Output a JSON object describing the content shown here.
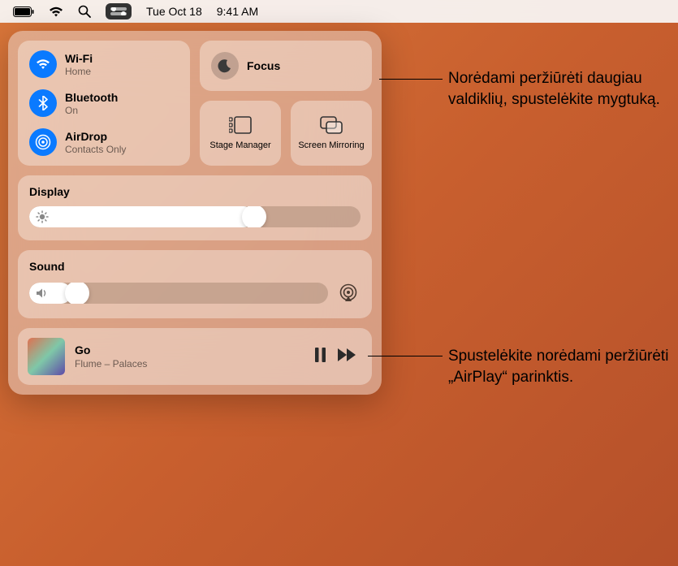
{
  "menubar": {
    "date": "Tue Oct 18",
    "time": "9:41 AM"
  },
  "connectivity": {
    "wifi": {
      "title": "Wi-Fi",
      "sub": "Home"
    },
    "bluetooth": {
      "title": "Bluetooth",
      "sub": "On"
    },
    "airdrop": {
      "title": "AirDrop",
      "sub": "Contacts Only"
    }
  },
  "focus": {
    "title": "Focus"
  },
  "stage_manager": {
    "label": "Stage Manager"
  },
  "screen_mirroring": {
    "label": "Screen Mirroring"
  },
  "display": {
    "label": "Display",
    "value_pct": 68
  },
  "sound": {
    "label": "Sound",
    "value_pct": 14
  },
  "now_playing": {
    "title": "Go",
    "sub": "Flume – Palaces"
  },
  "callouts": {
    "focus": "Norėdami peržiūrėti daugiau valdiklių, spustelėkite mygtuką.",
    "airplay": "Spustelėkite norėdami peržiūrėti „AirPlay“ parinktis."
  }
}
